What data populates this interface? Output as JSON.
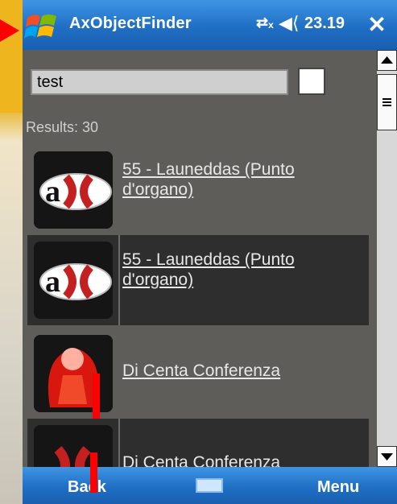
{
  "window": {
    "title": "AxObjectFinder",
    "clock": "23.19",
    "close_glyph": "✕",
    "signal_icon": "connectivity-icon",
    "volume_icon": "volume-icon"
  },
  "search": {
    "value": "test",
    "checked": false
  },
  "results_label": "Results: 30",
  "items": [
    {
      "name": "55 - Launeddas (Punto d'organo)",
      "icon": "ax-logo-icon",
      "selected": false
    },
    {
      "name": "55 - Launeddas (Punto d'organo)",
      "icon": "ax-logo-icon",
      "selected": true
    },
    {
      "name": "Di Centa Conferenza",
      "icon": "red-figure-icon",
      "selected": false
    },
    {
      "name": "Di Centa Conferenza",
      "icon": "ax-logo-icon",
      "selected": true
    }
  ],
  "softkeys": {
    "left": "Back",
    "right": "Menu"
  },
  "colors": {
    "titlebar": "#1f6fc5",
    "content_bg": "#5e5d59",
    "selected_row": "#2e2e2e",
    "annotation": "#ff0000"
  }
}
